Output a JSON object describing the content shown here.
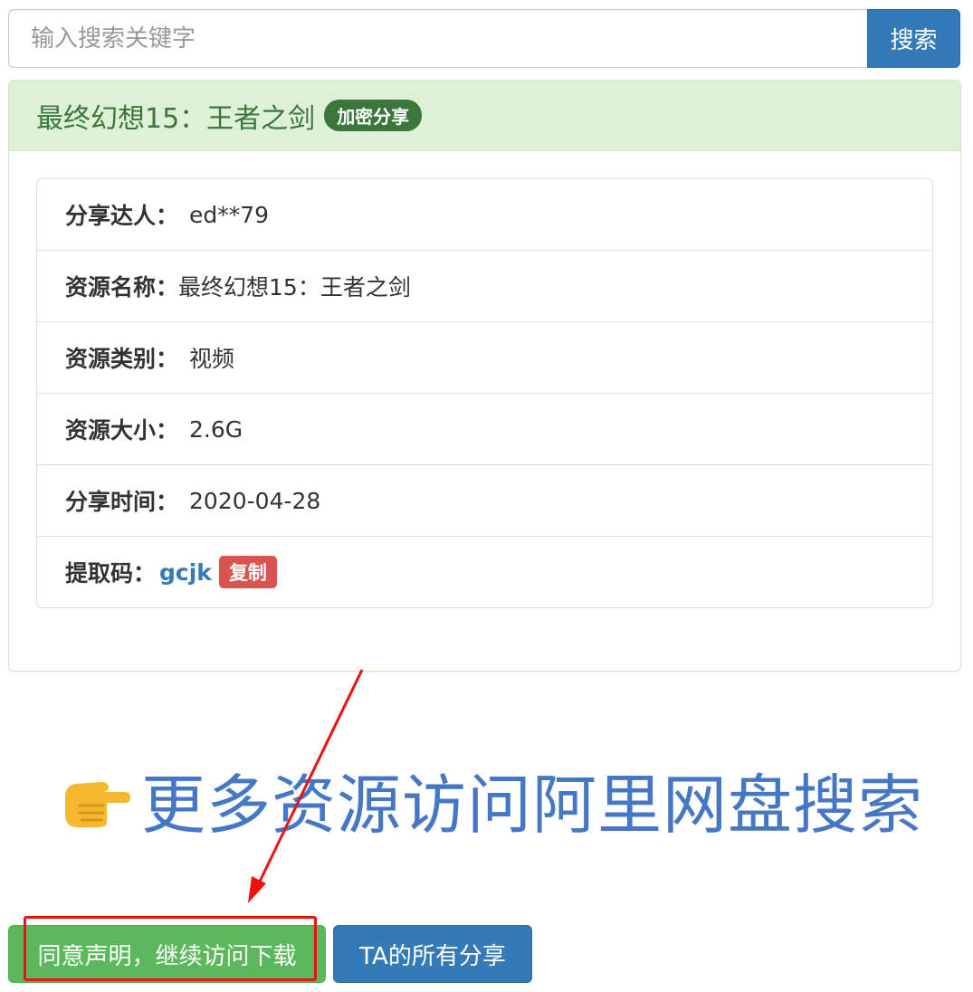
{
  "search": {
    "placeholder": "输入搜索关键字",
    "value": "",
    "button_label": "搜索"
  },
  "resource": {
    "title": "最终幻想15：王者之剑",
    "badge": "加密分享",
    "fields": {
      "sharer_label": "分享达人：",
      "sharer_value": "ed**79",
      "name_label": "资源名称：",
      "name_value": "最终幻想15：王者之剑",
      "category_label": "资源类别：",
      "category_value": "视频",
      "size_label": "资源大小：",
      "size_value": "2.6G",
      "time_label": "分享时间：",
      "time_value": "2020-04-28",
      "code_label": "提取码：",
      "code_value": "gcjk",
      "copy_label": "复制"
    }
  },
  "banner": {
    "icon": "pointing-hand-icon",
    "text": "更多资源访问阿里网盘搜索"
  },
  "actions": {
    "agree_label": "同意声明，继续访问下载",
    "all_shares_label": "TA的所有分享"
  },
  "colors": {
    "primary": "#337ab7",
    "success": "#5cb85c",
    "panel_heading_bg": "#dff0d8",
    "panel_heading_text": "#3c763d",
    "danger": "#d9534f",
    "banner_text": "#4477c6",
    "annotation_red": "#ee1111"
  }
}
